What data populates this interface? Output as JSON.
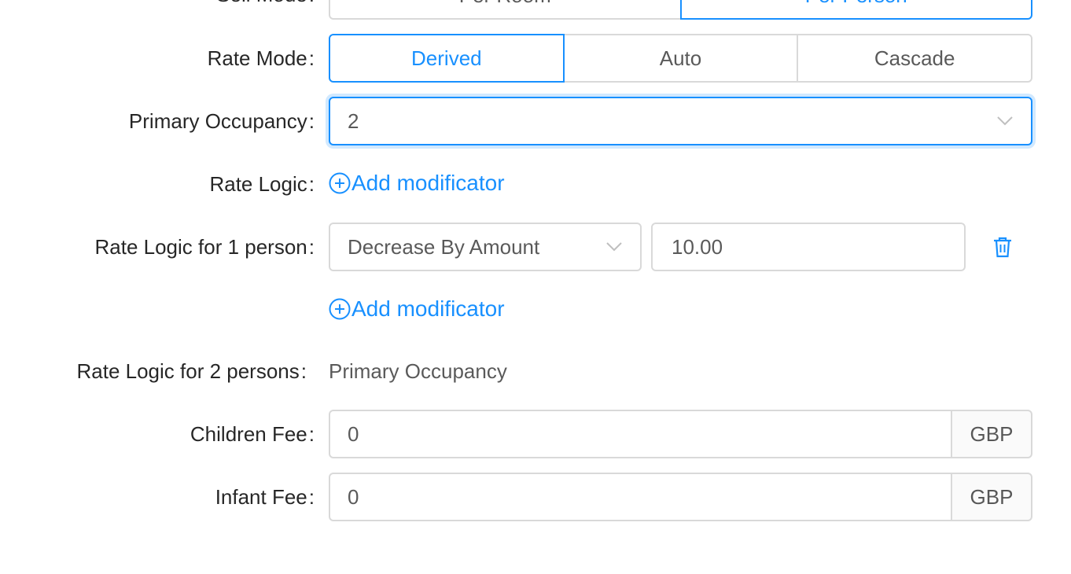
{
  "sell_mode": {
    "label": "Sell Mode",
    "options": [
      "Per Room",
      "Per Person"
    ],
    "selected": "Per Person"
  },
  "rate_mode": {
    "label": "Rate Mode",
    "options": [
      "Derived",
      "Auto",
      "Cascade"
    ],
    "selected": "Derived"
  },
  "primary_occupancy": {
    "label": "Primary Occupancy",
    "value": "2"
  },
  "rate_logic": {
    "label": "Rate Logic",
    "add_label": "Add modificator"
  },
  "rate_logic_1": {
    "label": "Rate Logic for 1 person",
    "type_value": "Decrease By Amount",
    "amount_value": "10.00",
    "add_label": "Add modificator"
  },
  "rate_logic_2": {
    "label": "Rate Logic for 2 persons",
    "value": "Primary Occupancy"
  },
  "children_fee": {
    "label": "Children Fee",
    "value": "0",
    "currency": "GBP"
  },
  "infant_fee": {
    "label": "Infant Fee",
    "value": "0",
    "currency": "GBP"
  },
  "colors": {
    "primary": "#1890ff",
    "border": "#d9d9d9"
  },
  "icons": {
    "chevron": "chevron-down-icon",
    "add": "plus-circle-icon",
    "delete": "trash-icon"
  }
}
